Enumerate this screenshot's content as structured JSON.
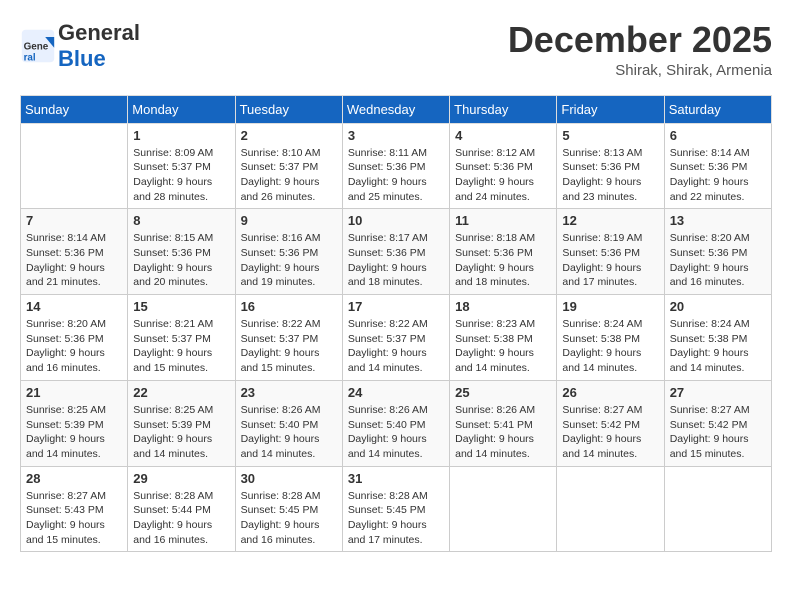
{
  "logo": {
    "general": "General",
    "blue": "Blue"
  },
  "title": "December 2025",
  "location": "Shirak, Shirak, Armenia",
  "weekdays": [
    "Sunday",
    "Monday",
    "Tuesday",
    "Wednesday",
    "Thursday",
    "Friday",
    "Saturday"
  ],
  "weeks": [
    [
      {
        "day": "",
        "info": ""
      },
      {
        "day": "1",
        "info": "Sunrise: 8:09 AM\nSunset: 5:37 PM\nDaylight: 9 hours\nand 28 minutes."
      },
      {
        "day": "2",
        "info": "Sunrise: 8:10 AM\nSunset: 5:37 PM\nDaylight: 9 hours\nand 26 minutes."
      },
      {
        "day": "3",
        "info": "Sunrise: 8:11 AM\nSunset: 5:36 PM\nDaylight: 9 hours\nand 25 minutes."
      },
      {
        "day": "4",
        "info": "Sunrise: 8:12 AM\nSunset: 5:36 PM\nDaylight: 9 hours\nand 24 minutes."
      },
      {
        "day": "5",
        "info": "Sunrise: 8:13 AM\nSunset: 5:36 PM\nDaylight: 9 hours\nand 23 minutes."
      },
      {
        "day": "6",
        "info": "Sunrise: 8:14 AM\nSunset: 5:36 PM\nDaylight: 9 hours\nand 22 minutes."
      }
    ],
    [
      {
        "day": "7",
        "info": "Sunrise: 8:14 AM\nSunset: 5:36 PM\nDaylight: 9 hours\nand 21 minutes."
      },
      {
        "day": "8",
        "info": "Sunrise: 8:15 AM\nSunset: 5:36 PM\nDaylight: 9 hours\nand 20 minutes."
      },
      {
        "day": "9",
        "info": "Sunrise: 8:16 AM\nSunset: 5:36 PM\nDaylight: 9 hours\nand 19 minutes."
      },
      {
        "day": "10",
        "info": "Sunrise: 8:17 AM\nSunset: 5:36 PM\nDaylight: 9 hours\nand 18 minutes."
      },
      {
        "day": "11",
        "info": "Sunrise: 8:18 AM\nSunset: 5:36 PM\nDaylight: 9 hours\nand 18 minutes."
      },
      {
        "day": "12",
        "info": "Sunrise: 8:19 AM\nSunset: 5:36 PM\nDaylight: 9 hours\nand 17 minutes."
      },
      {
        "day": "13",
        "info": "Sunrise: 8:20 AM\nSunset: 5:36 PM\nDaylight: 9 hours\nand 16 minutes."
      }
    ],
    [
      {
        "day": "14",
        "info": "Sunrise: 8:20 AM\nSunset: 5:36 PM\nDaylight: 9 hours\nand 16 minutes."
      },
      {
        "day": "15",
        "info": "Sunrise: 8:21 AM\nSunset: 5:37 PM\nDaylight: 9 hours\nand 15 minutes."
      },
      {
        "day": "16",
        "info": "Sunrise: 8:22 AM\nSunset: 5:37 PM\nDaylight: 9 hours\nand 15 minutes."
      },
      {
        "day": "17",
        "info": "Sunrise: 8:22 AM\nSunset: 5:37 PM\nDaylight: 9 hours\nand 14 minutes."
      },
      {
        "day": "18",
        "info": "Sunrise: 8:23 AM\nSunset: 5:38 PM\nDaylight: 9 hours\nand 14 minutes."
      },
      {
        "day": "19",
        "info": "Sunrise: 8:24 AM\nSunset: 5:38 PM\nDaylight: 9 hours\nand 14 minutes."
      },
      {
        "day": "20",
        "info": "Sunrise: 8:24 AM\nSunset: 5:38 PM\nDaylight: 9 hours\nand 14 minutes."
      }
    ],
    [
      {
        "day": "21",
        "info": "Sunrise: 8:25 AM\nSunset: 5:39 PM\nDaylight: 9 hours\nand 14 minutes."
      },
      {
        "day": "22",
        "info": "Sunrise: 8:25 AM\nSunset: 5:39 PM\nDaylight: 9 hours\nand 14 minutes."
      },
      {
        "day": "23",
        "info": "Sunrise: 8:26 AM\nSunset: 5:40 PM\nDaylight: 9 hours\nand 14 minutes."
      },
      {
        "day": "24",
        "info": "Sunrise: 8:26 AM\nSunset: 5:40 PM\nDaylight: 9 hours\nand 14 minutes."
      },
      {
        "day": "25",
        "info": "Sunrise: 8:26 AM\nSunset: 5:41 PM\nDaylight: 9 hours\nand 14 minutes."
      },
      {
        "day": "26",
        "info": "Sunrise: 8:27 AM\nSunset: 5:42 PM\nDaylight: 9 hours\nand 14 minutes."
      },
      {
        "day": "27",
        "info": "Sunrise: 8:27 AM\nSunset: 5:42 PM\nDaylight: 9 hours\nand 15 minutes."
      }
    ],
    [
      {
        "day": "28",
        "info": "Sunrise: 8:27 AM\nSunset: 5:43 PM\nDaylight: 9 hours\nand 15 minutes."
      },
      {
        "day": "29",
        "info": "Sunrise: 8:28 AM\nSunset: 5:44 PM\nDaylight: 9 hours\nand 16 minutes."
      },
      {
        "day": "30",
        "info": "Sunrise: 8:28 AM\nSunset: 5:45 PM\nDaylight: 9 hours\nand 16 minutes."
      },
      {
        "day": "31",
        "info": "Sunrise: 8:28 AM\nSunset: 5:45 PM\nDaylight: 9 hours\nand 17 minutes."
      },
      {
        "day": "",
        "info": ""
      },
      {
        "day": "",
        "info": ""
      },
      {
        "day": "",
        "info": ""
      }
    ]
  ]
}
